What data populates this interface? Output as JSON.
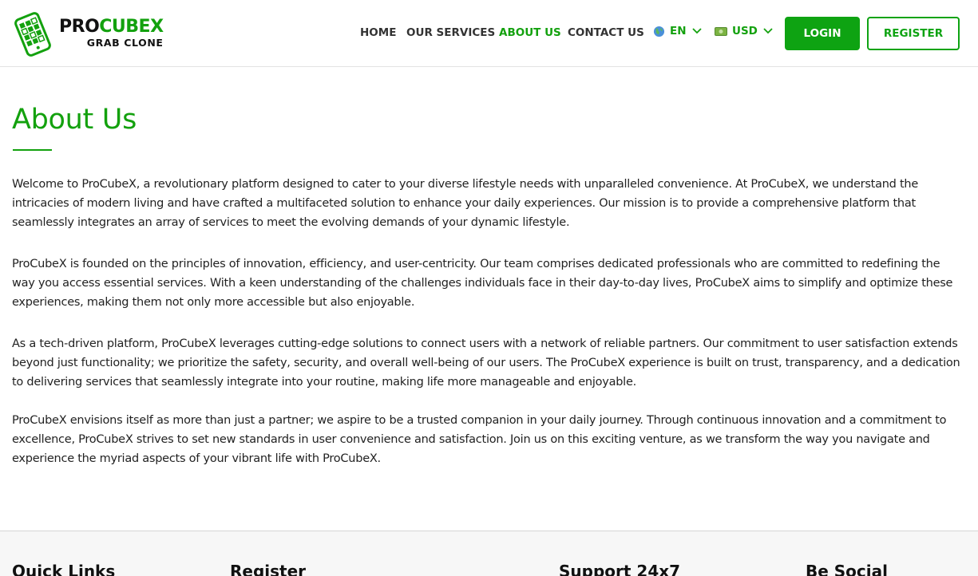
{
  "brand": {
    "name_prefix": "PRO",
    "name_accent": "CUBEX",
    "tagline": "GRAB CLONE",
    "logo_icon": "phone-grid-icon"
  },
  "nav": {
    "items": [
      {
        "label": "HOME",
        "active": false
      },
      {
        "label": "OUR SERVICES",
        "active": false
      },
      {
        "label": "ABOUT US",
        "active": true
      },
      {
        "label": "CONTACT US",
        "active": false
      }
    ],
    "language": {
      "label": "EN",
      "icon": "globe-icon"
    },
    "currency": {
      "label": "USD",
      "icon": "banknote-icon"
    },
    "login_label": "LOGIN",
    "register_label": "REGISTER"
  },
  "colors": {
    "accent": "#13a10e",
    "button_green": "#0ea312"
  },
  "main": {
    "title": "About Us",
    "paragraphs": [
      "Welcome to ProCubeX, a revolutionary platform designed to cater to your diverse lifestyle needs with unparalleled convenience. At ProCubeX, we understand the intricacies of modern living and have crafted a multifaceted solution to enhance your daily experiences. Our mission is to provide a comprehensive platform that seamlessly integrates an array of services to meet the evolving demands of your dynamic lifestyle.",
      "ProCubeX is founded on the principles of innovation, efficiency, and user-centricity. Our team comprises dedicated professionals who are committed to redefining the way you access essential services. With a keen understanding of the challenges individuals face in their day-to-day lives, ProCubeX aims to simplify and optimize these experiences, making them not only more accessible but also enjoyable.",
      "As a tech-driven platform, ProCubeX leverages cutting-edge solutions to connect users with a network of reliable partners. Our commitment to user satisfaction extends beyond just functionality; we prioritize the safety, security, and overall well-being of our users. The ProCubeX experience is built on trust, transparency, and a dedication to delivering services that seamlessly integrate into your routine, making life more manageable and enjoyable.",
      "ProCubeX envisions itself as more than just a partner; we aspire to be a trusted companion in your daily journey. Through continuous innovation and a commitment to excellence, ProCubeX strives to set new standards in user convenience and satisfaction. Join us on this exciting venture, as we transform the way you navigate and experience the myriad aspects of your vibrant life with ProCubeX."
    ]
  },
  "footer": {
    "headings": [
      "Quick Links",
      "Register",
      "Support 24x7",
      "Be Social"
    ]
  }
}
